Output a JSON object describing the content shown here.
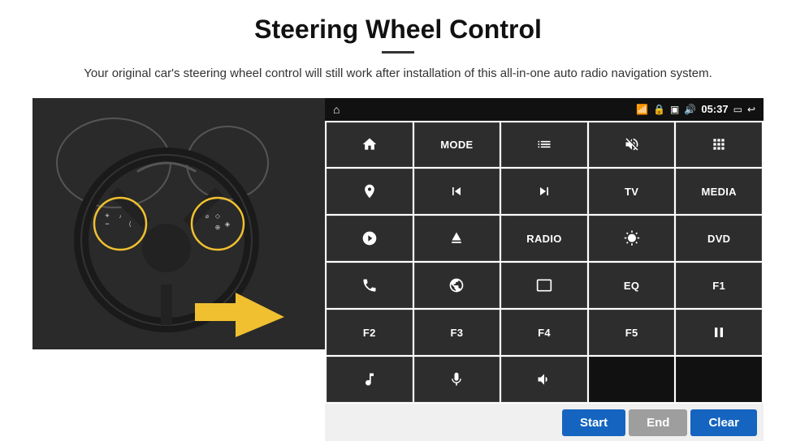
{
  "page": {
    "title": "Steering Wheel Control",
    "subtitle": "Your original car's steering wheel control will still work after installation of this all-in-one auto radio navigation system."
  },
  "statusBar": {
    "time": "05:37"
  },
  "buttons": [
    {
      "id": "home",
      "type": "icon",
      "icon": "home"
    },
    {
      "id": "mode",
      "type": "text",
      "label": "MODE"
    },
    {
      "id": "list",
      "type": "icon",
      "icon": "list"
    },
    {
      "id": "mute",
      "type": "icon",
      "icon": "mute"
    },
    {
      "id": "apps",
      "type": "icon",
      "icon": "apps"
    },
    {
      "id": "nav",
      "type": "icon",
      "icon": "nav"
    },
    {
      "id": "prev",
      "type": "icon",
      "icon": "prev"
    },
    {
      "id": "next",
      "type": "icon",
      "icon": "next"
    },
    {
      "id": "tv",
      "type": "text",
      "label": "TV"
    },
    {
      "id": "media",
      "type": "text",
      "label": "MEDIA"
    },
    {
      "id": "360",
      "type": "icon",
      "icon": "360cam"
    },
    {
      "id": "eject",
      "type": "icon",
      "icon": "eject"
    },
    {
      "id": "radio",
      "type": "text",
      "label": "RADIO"
    },
    {
      "id": "brightness",
      "type": "icon",
      "icon": "brightness"
    },
    {
      "id": "dvd",
      "type": "text",
      "label": "DVD"
    },
    {
      "id": "phone",
      "type": "icon",
      "icon": "phone"
    },
    {
      "id": "browse",
      "type": "icon",
      "icon": "browse"
    },
    {
      "id": "display",
      "type": "icon",
      "icon": "display"
    },
    {
      "id": "eq",
      "type": "text",
      "label": "EQ"
    },
    {
      "id": "f1",
      "type": "text",
      "label": "F1"
    },
    {
      "id": "f2",
      "type": "text",
      "label": "F2"
    },
    {
      "id": "f3",
      "type": "text",
      "label": "F3"
    },
    {
      "id": "f4",
      "type": "text",
      "label": "F4"
    },
    {
      "id": "f5",
      "type": "text",
      "label": "F5"
    },
    {
      "id": "playpause",
      "type": "icon",
      "icon": "playpause"
    },
    {
      "id": "music",
      "type": "icon",
      "icon": "music"
    },
    {
      "id": "mic",
      "type": "icon",
      "icon": "mic"
    },
    {
      "id": "volphone",
      "type": "icon",
      "icon": "volphone"
    },
    {
      "id": "empty1",
      "type": "empty"
    },
    {
      "id": "empty2",
      "type": "empty"
    }
  ],
  "bottomBar": {
    "startLabel": "Start",
    "endLabel": "End",
    "clearLabel": "Clear"
  }
}
